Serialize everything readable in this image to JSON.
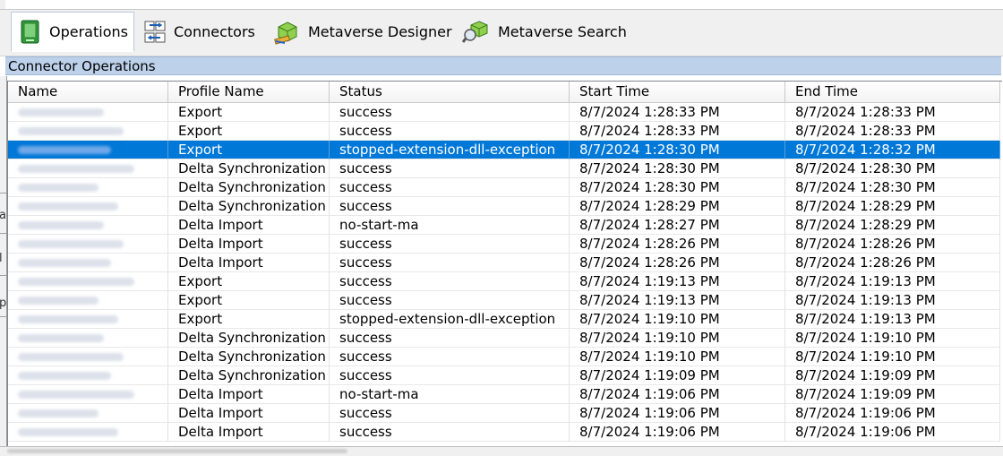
{
  "toolbar": {
    "items": [
      {
        "label": "Operations",
        "icon": "operations-icon",
        "active": true
      },
      {
        "label": "Connectors",
        "icon": "connectors-icon",
        "active": false
      },
      {
        "label": "Metaverse Designer",
        "icon": "metaverse-designer-icon",
        "active": false
      },
      {
        "label": "Metaverse Search",
        "icon": "metaverse-search-icon",
        "active": false
      }
    ]
  },
  "group_title": "Connector Operations",
  "table": {
    "columns": [
      "Name",
      "Profile Name",
      "Status",
      "Start Time",
      "End Time"
    ],
    "rows": [
      {
        "profile": "Export",
        "status": "success",
        "start": "8/7/2024 1:28:33 PM",
        "end": "8/7/2024 1:28:33 PM"
      },
      {
        "profile": "Export",
        "status": "success",
        "start": "8/7/2024 1:28:33 PM",
        "end": "8/7/2024 1:28:33 PM"
      },
      {
        "profile": "Export",
        "status": "stopped-extension-dll-exception",
        "start": "8/7/2024 1:28:30 PM",
        "end": "8/7/2024 1:28:32 PM",
        "selected": true
      },
      {
        "profile": "Delta Synchronization",
        "status": "success",
        "start": "8/7/2024 1:28:30 PM",
        "end": "8/7/2024 1:28:30 PM"
      },
      {
        "profile": "Delta Synchronization",
        "status": "success",
        "start": "8/7/2024 1:28:30 PM",
        "end": "8/7/2024 1:28:30 PM"
      },
      {
        "profile": "Delta Synchronization",
        "status": "success",
        "start": "8/7/2024 1:28:29 PM",
        "end": "8/7/2024 1:28:29 PM"
      },
      {
        "profile": "Delta Import",
        "status": "no-start-ma",
        "start": "8/7/2024 1:28:27 PM",
        "end": "8/7/2024 1:28:29 PM"
      },
      {
        "profile": "Delta Import",
        "status": "success",
        "start": "8/7/2024 1:28:26 PM",
        "end": "8/7/2024 1:28:26 PM"
      },
      {
        "profile": "Delta Import",
        "status": "success",
        "start": "8/7/2024 1:28:26 PM",
        "end": "8/7/2024 1:28:26 PM"
      },
      {
        "profile": "Export",
        "status": "success",
        "start": "8/7/2024 1:19:13 PM",
        "end": "8/7/2024 1:19:13 PM"
      },
      {
        "profile": "Export",
        "status": "success",
        "start": "8/7/2024 1:19:13 PM",
        "end": "8/7/2024 1:19:13 PM"
      },
      {
        "profile": "Export",
        "status": "stopped-extension-dll-exception",
        "start": "8/7/2024 1:19:10 PM",
        "end": "8/7/2024 1:19:13 PM"
      },
      {
        "profile": "Delta Synchronization",
        "status": "success",
        "start": "8/7/2024 1:19:10 PM",
        "end": "8/7/2024 1:19:10 PM"
      },
      {
        "profile": "Delta Synchronization",
        "status": "success",
        "start": "8/7/2024 1:19:10 PM",
        "end": "8/7/2024 1:19:10 PM"
      },
      {
        "profile": "Delta Synchronization",
        "status": "success",
        "start": "8/7/2024 1:19:09 PM",
        "end": "8/7/2024 1:19:09 PM"
      },
      {
        "profile": "Delta Import",
        "status": "no-start-ma",
        "start": "8/7/2024 1:19:06 PM",
        "end": "8/7/2024 1:19:09 PM"
      },
      {
        "profile": "Delta Import",
        "status": "success",
        "start": "8/7/2024 1:19:06 PM",
        "end": "8/7/2024 1:19:06 PM"
      },
      {
        "profile": "Delta Import",
        "status": "success",
        "start": "8/7/2024 1:19:06 PM",
        "end": "8/7/2024 1:19:06 PM"
      }
    ]
  },
  "colors": {
    "selection": "#0078d7",
    "group_header": "#bdd1ea",
    "toolbar_bg": "#f0f0f0"
  }
}
